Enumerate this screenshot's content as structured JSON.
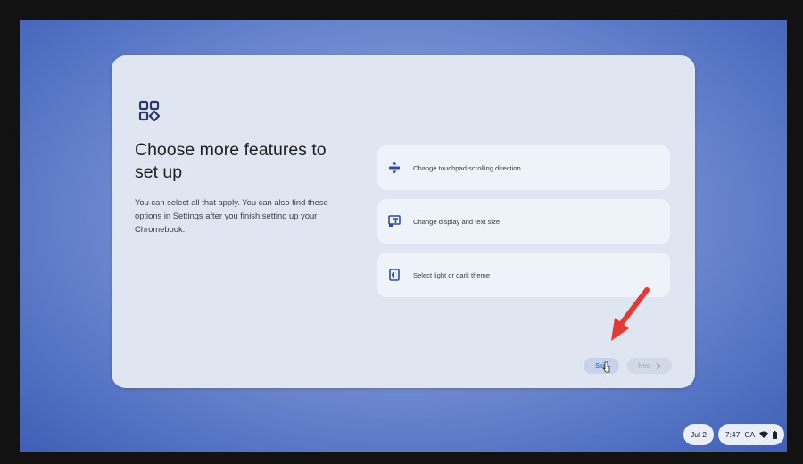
{
  "dialog": {
    "title": "Choose more features to set up",
    "description": "You can select all that apply. You can also find these options in Settings after you finish setting up your Chromebook.",
    "icon": "feature-grid-icon",
    "options": [
      {
        "label": "Change touchpad scrolling direction",
        "icon": "touchpad-scroll-icon"
      },
      {
        "label": "Change display and text size",
        "icon": "display-size-icon"
      },
      {
        "label": "Select light or dark theme",
        "icon": "theme-icon"
      }
    ],
    "skip_label": "Skip",
    "next_label": "Next"
  },
  "shelf": {
    "date": "Jul 2",
    "time": "7:47",
    "region": "CA"
  },
  "colors": {
    "accent": "#1a4fa8",
    "annotation_arrow": "#e53935"
  }
}
